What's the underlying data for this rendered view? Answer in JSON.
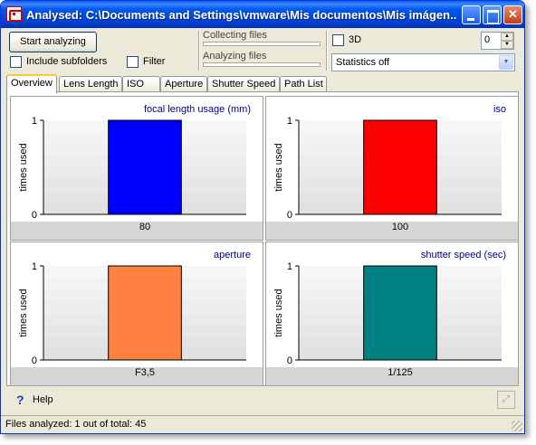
{
  "window": {
    "title": "Analysed: C:\\Documents and Settings\\vmware\\Mis documentos\\Mis imágen..."
  },
  "toolbar": {
    "start_label": "Start analyzing",
    "include_subfolders_label": "Include subfolders",
    "filter_label": "Filter",
    "collecting_label": "Collecting files",
    "analyzing_label": "Analyzing files",
    "three_d_label": "3D",
    "spin_value": "0",
    "statistics_value": "Statistics off"
  },
  "tabs": [
    "Overview",
    "Lens Length",
    "ISO",
    "Aperture",
    "Shutter Speed",
    "Path List"
  ],
  "footer": {
    "help_label": "Help",
    "status_text": "Files analyzed: 1 out of total: 45"
  },
  "colors": {
    "focal": "#0000ff",
    "iso": "#ff0000",
    "aperture": "#ff8040",
    "shutter": "#008080"
  },
  "chart_data": [
    {
      "type": "bar",
      "title": "focal length usage (mm)",
      "ylabel": "times used",
      "categories": [
        "80"
      ],
      "values": [
        1
      ],
      "ylim": [
        0,
        1
      ],
      "yticks": [
        "0",
        "1"
      ],
      "color": "#0000ff",
      "grid": true
    },
    {
      "type": "bar",
      "title": "iso",
      "ylabel": "times used",
      "categories": [
        "100"
      ],
      "values": [
        1
      ],
      "ylim": [
        0,
        1
      ],
      "yticks": [
        "0",
        "1"
      ],
      "color": "#ff0000",
      "grid": true
    },
    {
      "type": "bar",
      "title": "aperture",
      "ylabel": "times used",
      "categories": [
        "F3,5"
      ],
      "values": [
        1
      ],
      "ylim": [
        0,
        1
      ],
      "yticks": [
        "0",
        "1"
      ],
      "color": "#ff8040",
      "grid": true
    },
    {
      "type": "bar",
      "title": "shutter speed (sec)",
      "ylabel": "times used",
      "categories": [
        "1/125"
      ],
      "values": [
        1
      ],
      "ylim": [
        0,
        1
      ],
      "yticks": [
        "0",
        "1"
      ],
      "color": "#008080",
      "grid": true
    }
  ]
}
